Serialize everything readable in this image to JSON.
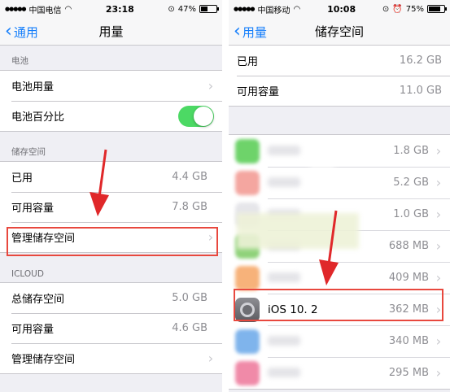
{
  "left": {
    "status": {
      "carrier": "中国电信",
      "time": "23:18",
      "battery": "47%",
      "battery_level": 0.47
    },
    "nav": {
      "back": "通用",
      "title": "用量"
    },
    "sections": {
      "battery_header": "电池",
      "battery_usage": "电池用量",
      "battery_percent": "电池百分比",
      "storage_header": "储存空间",
      "used_label": "已用",
      "used_value": "4.4 GB",
      "available_label": "可用容量",
      "available_value": "7.8 GB",
      "manage_label": "管理储存空间",
      "icloud_header": "ICLOUD",
      "icloud_total_label": "总储存空间",
      "icloud_total_value": "5.0 GB",
      "icloud_available_label": "可用容量",
      "icloud_available_value": "4.6 GB",
      "icloud_manage_label": "管理储存空间"
    },
    "toggle_on": true
  },
  "right": {
    "status": {
      "carrier": "中国移动",
      "time": "10:08",
      "battery": "75%",
      "battery_level": 0.75
    },
    "nav": {
      "back": "用量",
      "title": "储存空间"
    },
    "used_label": "已用",
    "used_value": "16.2 GB",
    "available_label": "可用容量",
    "available_value": "11.0 GB",
    "apps": [
      {
        "size": "1.8 GB",
        "color": "#6ed36a"
      },
      {
        "size": "5.2 GB",
        "color": "#f4a6a0"
      },
      {
        "size": "1.0 GB",
        "color": "#e6e6ea"
      },
      {
        "size": "688 MB",
        "color": "#8fd27a"
      },
      {
        "size": "409 MB",
        "color": "#f7b27a"
      },
      {
        "name": "iOS 10. 2",
        "size": "362 MB",
        "icon": "settings-gear-icon"
      },
      {
        "size": "340 MB",
        "color": "#7fb4ec"
      },
      {
        "size": "295 MB",
        "color": "#f08aa8"
      }
    ]
  },
  "colors": {
    "accent": "#147efb",
    "toggle": "#4cd964",
    "highlight": "#e8483e",
    "arrow": "#e0282a"
  }
}
